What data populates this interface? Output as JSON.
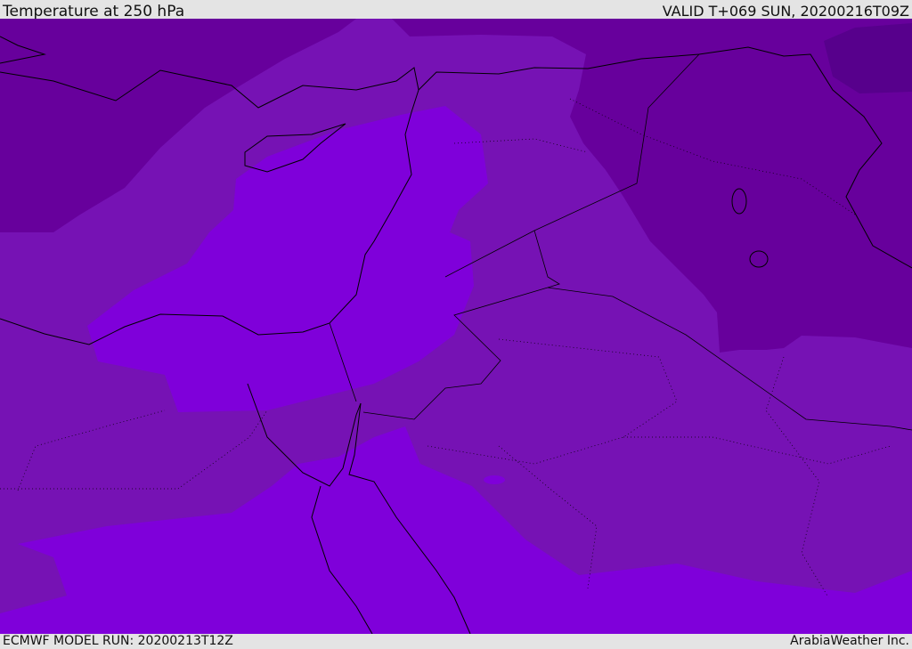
{
  "header": {
    "title": "Temperature at 250 hPa",
    "valid": "VALID T+069 SUN, 20200216T09Z"
  },
  "footer": {
    "model_run": "ECMWF MODEL RUN: 20200213T12Z",
    "brand": "ArabiaWeather Inc."
  },
  "colors": {
    "darkest": "#57008c",
    "dark": "#67009c",
    "mid": "#7612b4",
    "bright": "#7f00da",
    "header_bg": "#e4e4e4"
  }
}
